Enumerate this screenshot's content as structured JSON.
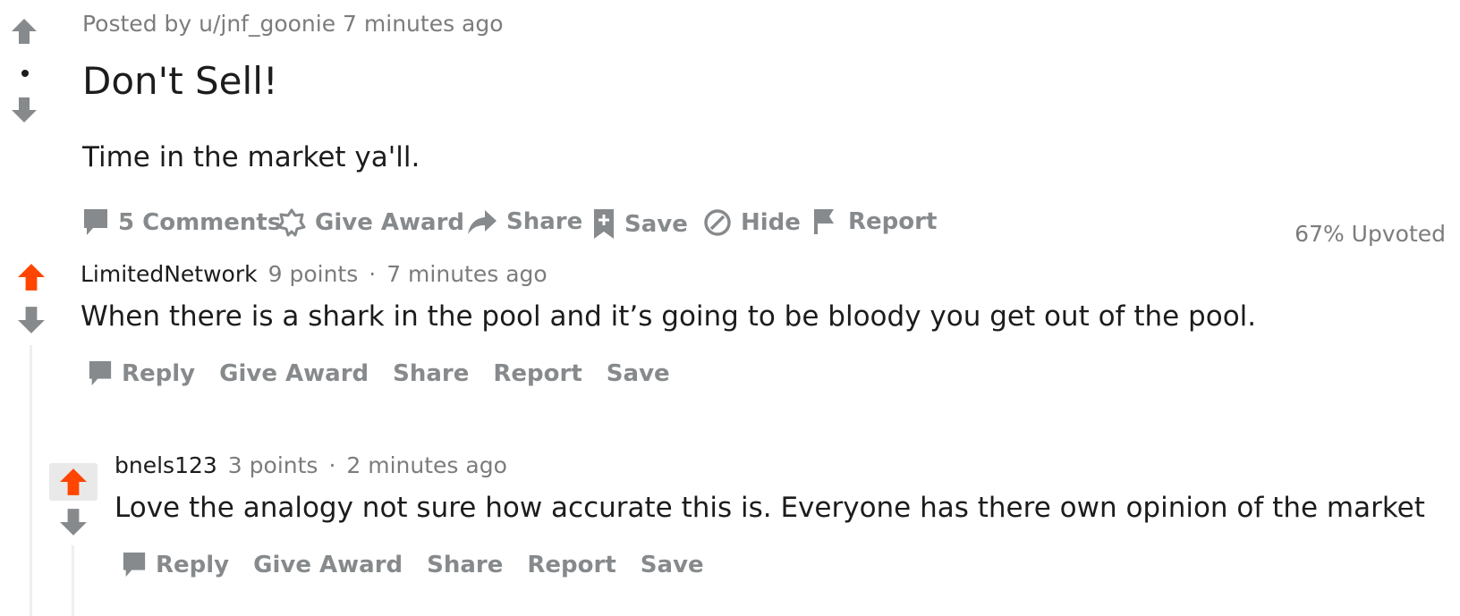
{
  "post": {
    "meta": "Posted by u/jnf_goonie 7 minutes ago",
    "title": "Don't Sell!",
    "body": "Time in the market ya'll.",
    "actions": {
      "comments": "5 Comments",
      "give_award": "Give Award",
      "share": "Share",
      "save": "Save",
      "hide": "Hide",
      "report": "Report"
    },
    "upvoted": "67% Upvoted"
  },
  "comments": [
    {
      "author": "LimitedNetwork",
      "points": "9 points",
      "separator": "·",
      "time": "7 minutes ago",
      "body": "When there is a shark in the pool and it’s going to be bloody you get out of the pool.",
      "actions": {
        "reply": "Reply",
        "give_award": "Give Award",
        "share": "Share",
        "report": "Report",
        "save": "Save"
      }
    },
    {
      "author": "bnels123",
      "points": "3 points",
      "separator": "·",
      "time": "2 minutes ago",
      "body": "Love the analogy not sure how accurate this is. Everyone has there own opinion of the market",
      "actions": {
        "reply": "Reply",
        "give_award": "Give Award",
        "share": "Share",
        "report": "Report",
        "save": "Save"
      }
    }
  ],
  "colors": {
    "upvote_active": "#ff4500",
    "icon_gray": "#878a8c",
    "text": "#1c1c1c",
    "meta": "#7c7c7c",
    "thread_line": "#edeff1"
  },
  "icons": {
    "post_upvote": "arrow-up-icon",
    "post_downvote": "arrow-down-icon",
    "comments": "speech-bubble-icon",
    "give_award": "award-icon",
    "share": "share-arrow-icon",
    "save": "bookmark-plus-icon",
    "hide": "slash-circle-icon",
    "report": "flag-icon"
  }
}
